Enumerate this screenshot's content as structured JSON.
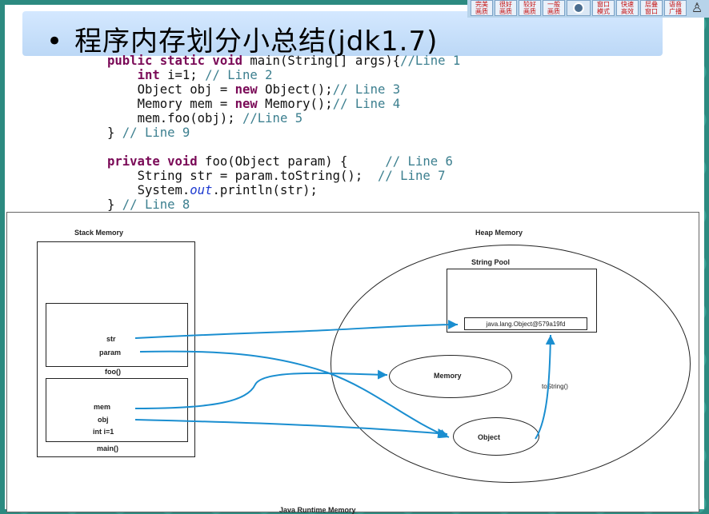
{
  "title": {
    "bullet": "•",
    "text": "程序内存划分小总结(jdk1.7)"
  },
  "toolbar": {
    "buttons": [
      {
        "line1": "完美",
        "line2": "画质"
      },
      {
        "line1": "很好",
        "line2": "画质"
      },
      {
        "line1": "较好",
        "line2": "画质"
      },
      {
        "line1": "一般",
        "line2": "画质"
      }
    ],
    "buttons2": [
      {
        "line1": "窗口",
        "line2": "模式"
      },
      {
        "line1": "快速",
        "line2": "高效"
      },
      {
        "line1": "层叠",
        "line2": "窗口"
      },
      {
        "line1": "语音",
        "line2": "广播"
      }
    ]
  },
  "code_lines": {
    "l1a": "public static void",
    "l1b": " main(String[] args){",
    "l1c": "//Line 1",
    "l2a": "int",
    "l2b": " i=1; ",
    "l2c": "// Line 2",
    "l3a": "Object obj = ",
    "l3b": "new",
    "l3c": " Object();",
    "l3d": "// Line 3",
    "l4a": "Memory mem = ",
    "l4b": "new",
    "l4c": " Memory();",
    "l4d": "// Line 4",
    "l5a": "mem.foo(obj); ",
    "l5b": "//Line 5",
    "l6a": "} ",
    "l6b": "// Line 9",
    "l7a": "private void",
    "l7b": " foo(Object param) {     ",
    "l7c": "// Line 6",
    "l8a": "String str = param.toString();  ",
    "l8b": "// Line 7",
    "l9a": "System.",
    "l9b": "out",
    "l9c": ".println(str);",
    "l10a": "} ",
    "l10b": "// Line 8"
  },
  "diagram": {
    "stack_title": "Stack Memory",
    "heap_title": "Heap Memory",
    "string_pool": "String Pool",
    "string_value": "java.lang.Object@579a19fd",
    "str": "str",
    "param": "param",
    "foo_frame": "foo()",
    "mem": "mem",
    "obj": "obj",
    "int_i": "int i=1",
    "main_frame": "main()",
    "memory_obj": "Memory",
    "object_obj": "Object",
    "tostring": "toString()",
    "footer": "Java Runtime Memory",
    "arrow_color": "#1a8ed0"
  }
}
